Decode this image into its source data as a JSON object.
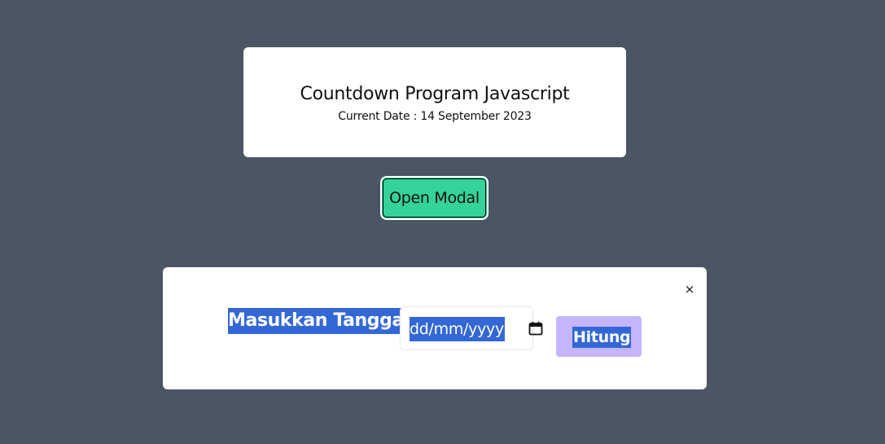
{
  "header": {
    "title": "Countdown Program Javascript",
    "current_date": "Current Date : 14 September 2023"
  },
  "open_modal_label": "Open Modal",
  "modal": {
    "close_symbol": "×",
    "label": "Masukkan Tanggal",
    "date_placeholder": "dd/mm/yyyy",
    "submit_label": "Hitung"
  },
  "icons": {
    "close": "close-icon",
    "calendar": "calendar-icon"
  },
  "colors": {
    "background": "#4b5563",
    "open_modal_button": "#34d399",
    "hitung_button": "#c4b5fd",
    "selection_highlight": "#3367d6"
  }
}
